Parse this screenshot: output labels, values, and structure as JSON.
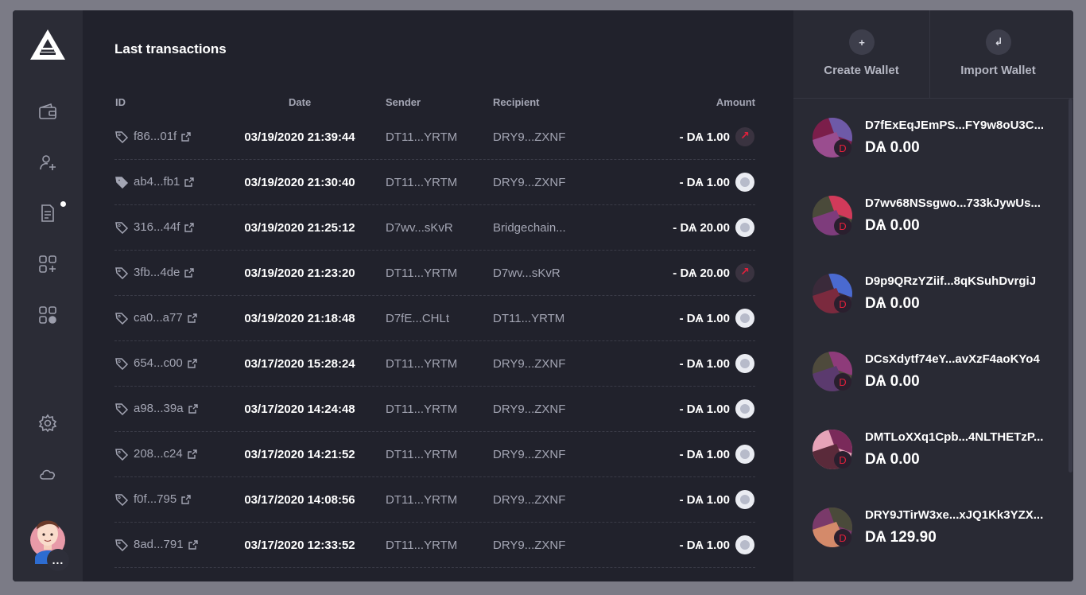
{
  "main": {
    "title": "Last transactions",
    "columns": {
      "id": "ID",
      "date": "Date",
      "sender": "Sender",
      "recipient": "Recipient",
      "amount": "Amount"
    },
    "transactions": [
      {
        "id": "f86...01f",
        "date": "03/19/2020 21:39:44",
        "sender": "DT11...YRTM",
        "recipient": "DRY9...ZXNF",
        "amount": "- DѦ 1.00",
        "direction": "sent"
      },
      {
        "id": "ab4...fb1",
        "date": "03/19/2020 21:30:40",
        "sender": "DT11...YRTM",
        "recipient": "DRY9...ZXNF",
        "amount": "- DѦ 1.00",
        "direction": "self"
      },
      {
        "id": "316...44f",
        "date": "03/19/2020 21:25:12",
        "sender": "D7wv...sKvR",
        "recipient": "Bridgechain...",
        "amount": "- DѦ 20.00",
        "direction": "self"
      },
      {
        "id": "3fb...4de",
        "date": "03/19/2020 21:23:20",
        "sender": "DT11...YRTM",
        "recipient": "D7wv...sKvR",
        "amount": "- DѦ 20.00",
        "direction": "sent"
      },
      {
        "id": "ca0...a77",
        "date": "03/19/2020 21:18:48",
        "sender": "D7fE...CHLt",
        "recipient": "DT11...YRTM",
        "amount": "- DѦ 1.00",
        "direction": "self"
      },
      {
        "id": "654...c00",
        "date": "03/17/2020 15:28:24",
        "sender": "DT11...YRTM",
        "recipient": "DRY9...ZXNF",
        "amount": "- DѦ 1.00",
        "direction": "self"
      },
      {
        "id": "a98...39a",
        "date": "03/17/2020 14:24:48",
        "sender": "DT11...YRTM",
        "recipient": "DRY9...ZXNF",
        "amount": "- DѦ 1.00",
        "direction": "self"
      },
      {
        "id": "208...c24",
        "date": "03/17/2020 14:21:52",
        "sender": "DT11...YRTM",
        "recipient": "DRY9...ZXNF",
        "amount": "- DѦ 1.00",
        "direction": "self"
      },
      {
        "id": "f0f...795",
        "date": "03/17/2020 14:08:56",
        "sender": "DT11...YRTM",
        "recipient": "DRY9...ZXNF",
        "amount": "- DѦ 1.00",
        "direction": "self"
      },
      {
        "id": "8ad...791",
        "date": "03/17/2020 12:33:52",
        "sender": "DT11...YRTM",
        "recipient": "DRY9...ZXNF",
        "amount": "- DѦ 1.00",
        "direction": "self"
      }
    ]
  },
  "sidebar": {
    "items": [
      {
        "name": "wallet-icon"
      },
      {
        "name": "add-contact-icon"
      },
      {
        "name": "transactions-icon"
      },
      {
        "name": "plugins-icon"
      },
      {
        "name": "plugin-manager-icon"
      },
      {
        "name": "settings-icon"
      },
      {
        "name": "network-icon"
      }
    ],
    "more_label": "..."
  },
  "right_panel": {
    "create_wallet": {
      "label": "Create Wallet",
      "icon": "+"
    },
    "import_wallet": {
      "label": "Import Wallet",
      "icon": "↲"
    },
    "wallets": [
      {
        "name": "D7fExEqJEmPS...FY9w8oU3C...",
        "balance": "DѦ 0.00",
        "colors": [
          "#7b1e4a",
          "#6e5aa8",
          "#9a4d8f"
        ]
      },
      {
        "name": "D7wv68NSsgwo...733kJywUs...",
        "balance": "DѦ 0.00",
        "colors": [
          "#4a4a3a",
          "#d13a5a",
          "#7e3c7c"
        ]
      },
      {
        "name": "D9p9QRzYZiif...8qKSuhDvrgiJ",
        "balance": "DѦ 0.00",
        "colors": [
          "#3a2a3a",
          "#4a6ad0",
          "#7b2a3e"
        ]
      },
      {
        "name": "DCsXdytf74eY...avXzF4aoKYo4",
        "balance": "DѦ 0.00",
        "colors": [
          "#4e4a3c",
          "#8e3b7a",
          "#5b3a6e"
        ]
      },
      {
        "name": "DMTLoXXq1Cpb...4NLTHETzP...",
        "balance": "DѦ 0.00",
        "colors": [
          "#e6a3b8",
          "#7a2a5a",
          "#5a2a3a"
        ]
      },
      {
        "name": "DRY9JTirW3xe...xJQ1Kk3YZX...",
        "balance": "DѦ 129.90",
        "colors": [
          "#7a3a6a",
          "#4a4a3a",
          "#d48a6a"
        ]
      }
    ]
  },
  "colors": {
    "accent_red": "#e2203b",
    "background": "#21222c",
    "sidebar": "#2b2c36",
    "panel": "#292a34"
  }
}
